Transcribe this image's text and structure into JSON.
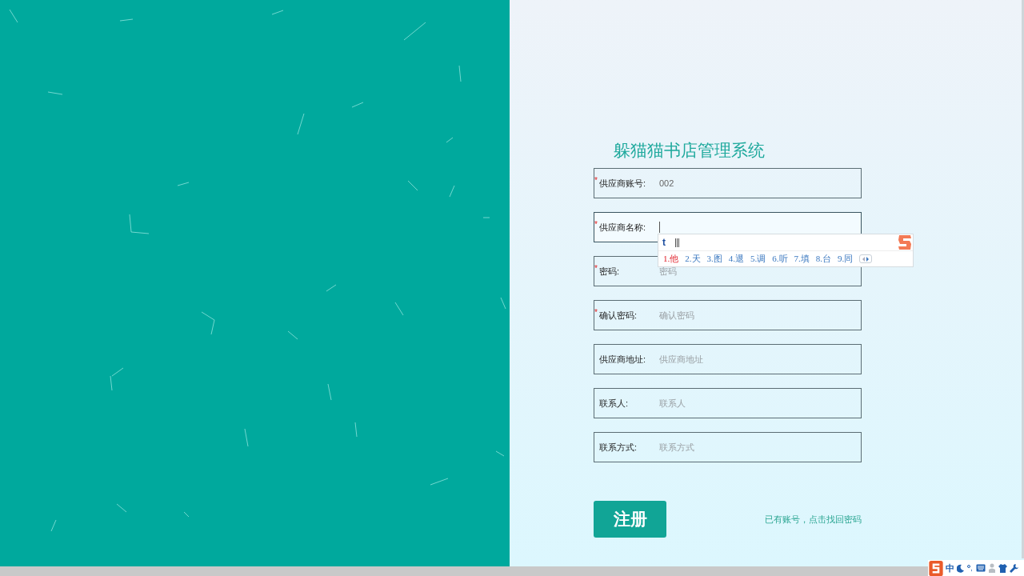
{
  "title": "躲猫猫书店管理系统",
  "fields": [
    {
      "label": "供应商账号:",
      "required_mark": "*",
      "value": "002",
      "focused": false
    },
    {
      "label": "供应商名称:",
      "required_mark": "*",
      "focused": true
    },
    {
      "label": "密码:",
      "required_mark": "*",
      "placeholder": "密码",
      "focused": false
    },
    {
      "label": "确认密码:",
      "required_mark": "*",
      "placeholder": "确认密码",
      "focused": false
    },
    {
      "label": "供应商地址:",
      "placeholder": "供应商地址",
      "focused": false
    },
    {
      "label": "联系人:",
      "placeholder": "联系人",
      "focused": false
    },
    {
      "label": "联系方式:",
      "placeholder": "联系方式",
      "focused": false
    }
  ],
  "register_button": "注册",
  "login_link": "已有账号，点击找回密码",
  "ime_popup": {
    "composition": "t",
    "candidates": [
      {
        "text": "1.他",
        "selected": true
      },
      {
        "text": "2.天",
        "selected": false
      },
      {
        "text": "3.图",
        "selected": false
      },
      {
        "text": "4.退",
        "selected": false
      },
      {
        "text": "5.调",
        "selected": false
      },
      {
        "text": "6.听",
        "selected": false
      },
      {
        "text": "7.填",
        "selected": false
      },
      {
        "text": "8.台",
        "selected": false
      },
      {
        "text": "9.同",
        "selected": false
      }
    ]
  },
  "ime_toolbar": {
    "mode": "中"
  }
}
